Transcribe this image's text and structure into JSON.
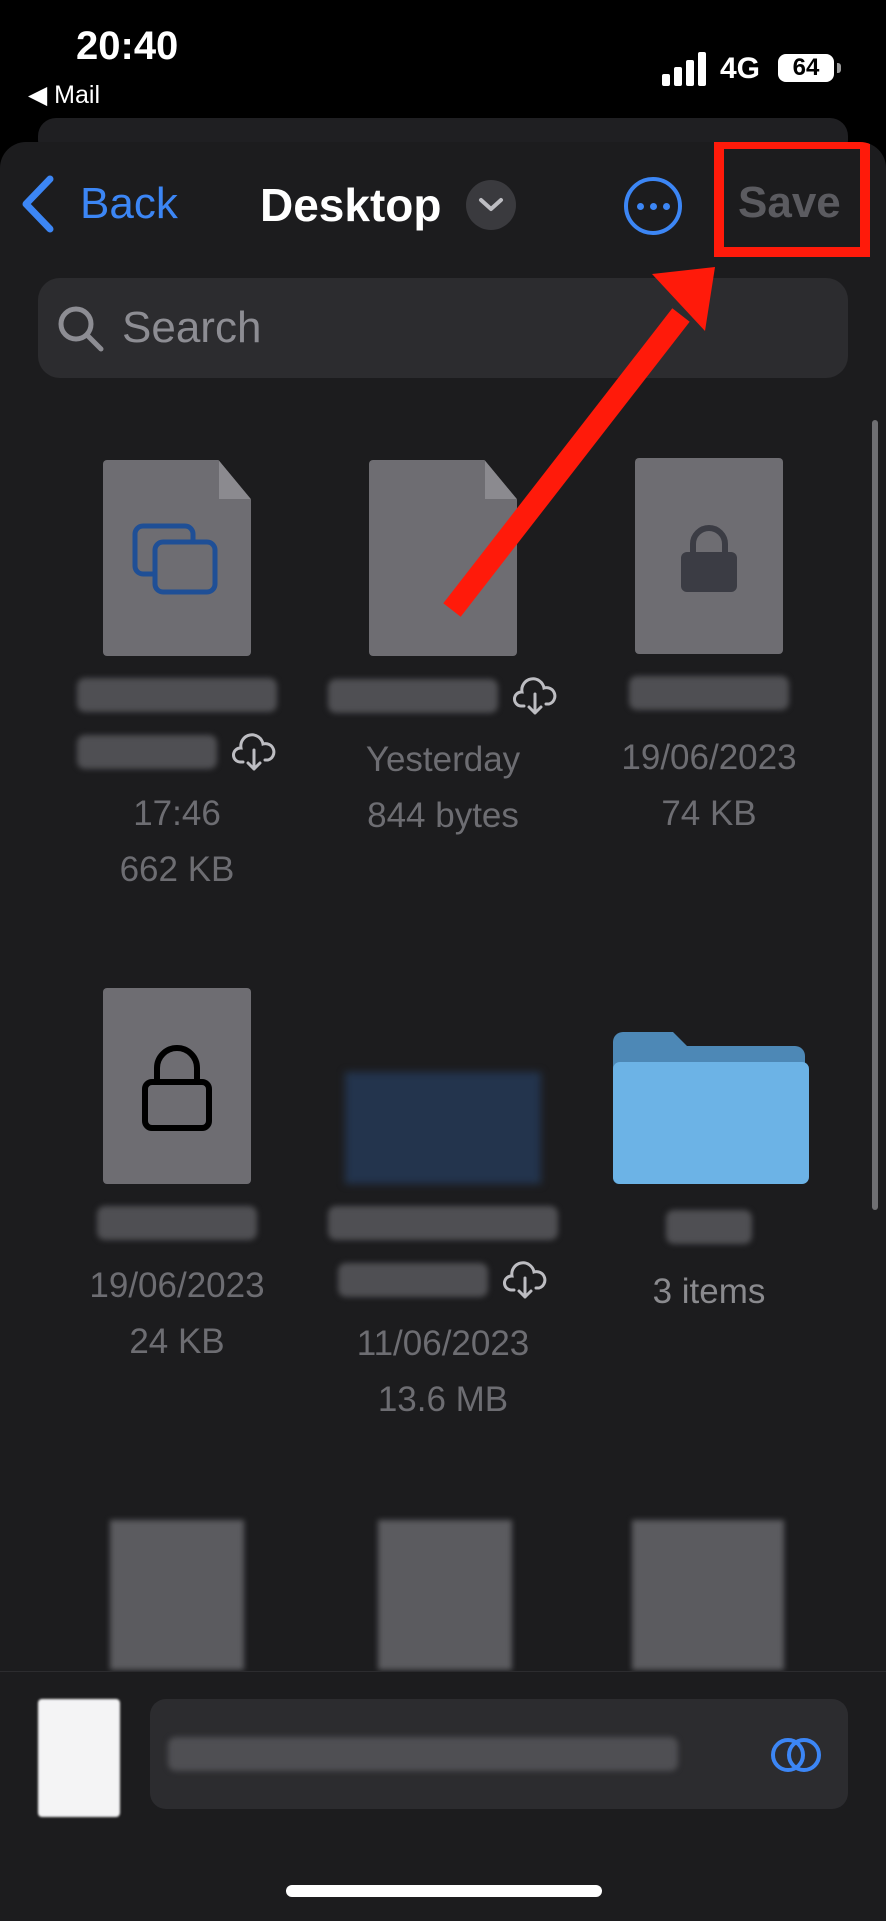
{
  "status_bar": {
    "time": "20:40",
    "back_to_app": "◀ Mail",
    "network": "4G",
    "battery": "64"
  },
  "nav": {
    "back_label": "Back",
    "title": "Desktop",
    "save_label": "Save"
  },
  "search": {
    "placeholder": "Search"
  },
  "files": [
    {
      "date": "17:46",
      "size": "662 KB"
    },
    {
      "date": "Yesterday",
      "size": "844 bytes"
    },
    {
      "date": "19/06/2023",
      "size": "74 KB"
    },
    {
      "date": "19/06/2023",
      "size": "24 KB"
    },
    {
      "date": "11/06/2023",
      "size": "13.6 MB"
    },
    {
      "count": "3 items"
    }
  ],
  "colors": {
    "accent": "#3c86f5",
    "highlight": "#ff1a0a",
    "folder": "#6cb3e6"
  }
}
